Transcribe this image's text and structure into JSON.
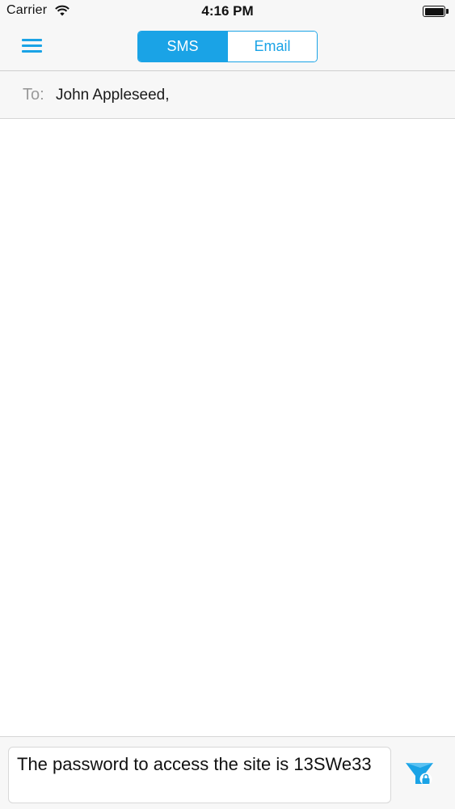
{
  "status_bar": {
    "carrier": "Carrier",
    "time": "4:16 PM"
  },
  "nav": {
    "menu_icon": "hamburger-menu-icon",
    "segments": [
      {
        "label": "SMS",
        "selected": true
      },
      {
        "label": "Email",
        "selected": false
      }
    ]
  },
  "recipient": {
    "label": "To:",
    "value": "John Appleseed,"
  },
  "compose": {
    "message": "The password to access the site is 13SWe33",
    "send_icon": "send-secure-icon"
  },
  "colors": {
    "accent": "#1AA3E6",
    "bar_background": "#F7F7F7"
  }
}
